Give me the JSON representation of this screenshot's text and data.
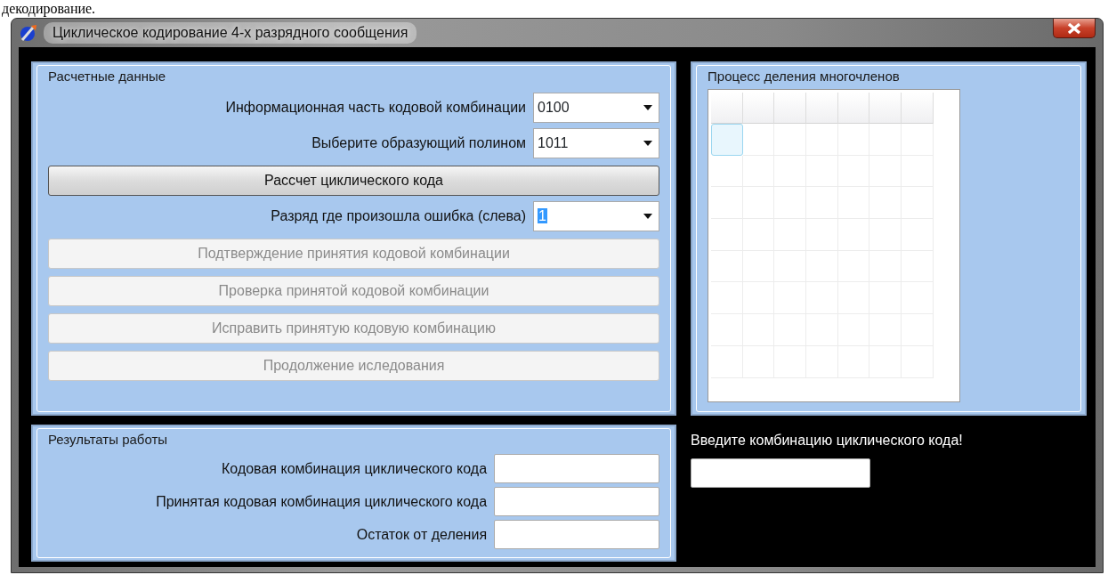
{
  "document_text": "декодирование.",
  "window": {
    "title": "Циклическое кодирование 4-х разрядного сообщения"
  },
  "input_group": {
    "title": "Расчетные данные",
    "controls": [
      {
        "kind": "dropdown",
        "label": "Информационная часть кодовой комбинации",
        "value": "0100",
        "text_selected": false
      },
      {
        "kind": "dropdown",
        "label": "Выберите образующий полином",
        "value": "1011",
        "text_selected": false
      },
      {
        "kind": "button",
        "label": "Рассчет циклического кода",
        "disabled": false
      },
      {
        "kind": "dropdown",
        "label": "Разряд где произошла ошибка (слева)",
        "value": "1",
        "text_selected": true
      },
      {
        "kind": "button",
        "label": "Подтверждение принятия кодовой комбинации",
        "disabled": true
      },
      {
        "kind": "button",
        "label": "Проверка принятой кодовой комбинации",
        "disabled": true
      },
      {
        "kind": "button",
        "label": "Исправить принятую кодовую комбинацию",
        "disabled": true
      },
      {
        "kind": "button",
        "label": "Продолжение иследования",
        "disabled": true
      }
    ]
  },
  "division_group": {
    "title": "Процесс деления многочленов",
    "grid": {
      "rows": [
        {
          "cells": [
            {
              "selected": true
            },
            {
              "selected": false
            },
            {
              "selected": false
            },
            {
              "selected": false
            },
            {
              "selected": false
            },
            {
              "selected": false
            },
            {
              "selected": false
            }
          ]
        },
        {
          "cells": [
            {
              "selected": false
            },
            {
              "selected": false
            },
            {
              "selected": false
            },
            {
              "selected": false
            },
            {
              "selected": false
            },
            {
              "selected": false
            },
            {
              "selected": false
            }
          ]
        },
        {
          "cells": [
            {
              "selected": false
            },
            {
              "selected": false
            },
            {
              "selected": false
            },
            {
              "selected": false
            },
            {
              "selected": false
            },
            {
              "selected": false
            },
            {
              "selected": false
            }
          ]
        },
        {
          "cells": [
            {
              "selected": false
            },
            {
              "selected": false
            },
            {
              "selected": false
            },
            {
              "selected": false
            },
            {
              "selected": false
            },
            {
              "selected": false
            },
            {
              "selected": false
            }
          ]
        },
        {
          "cells": [
            {
              "selected": false
            },
            {
              "selected": false
            },
            {
              "selected": false
            },
            {
              "selected": false
            },
            {
              "selected": false
            },
            {
              "selected": false
            },
            {
              "selected": false
            }
          ]
        },
        {
          "cells": [
            {
              "selected": false
            },
            {
              "selected": false
            },
            {
              "selected": false
            },
            {
              "selected": false
            },
            {
              "selected": false
            },
            {
              "selected": false
            },
            {
              "selected": false
            }
          ]
        },
        {
          "cells": [
            {
              "selected": false
            },
            {
              "selected": false
            },
            {
              "selected": false
            },
            {
              "selected": false
            },
            {
              "selected": false
            },
            {
              "selected": false
            },
            {
              "selected": false
            }
          ]
        },
        {
          "cells": [
            {
              "selected": false
            },
            {
              "selected": false
            },
            {
              "selected": false
            },
            {
              "selected": false
            },
            {
              "selected": false
            },
            {
              "selected": false
            },
            {
              "selected": false
            }
          ]
        }
      ]
    }
  },
  "results_group": {
    "title": "Результаты работы",
    "fields": [
      {
        "label": "Кодовая комбинация циклического кода"
      },
      {
        "label": "Принятая кодовая комбинация циклического кода"
      },
      {
        "label": "Остаток от деления"
      }
    ]
  },
  "prompt": {
    "text": "Введите комбинацию циклического кода!"
  }
}
